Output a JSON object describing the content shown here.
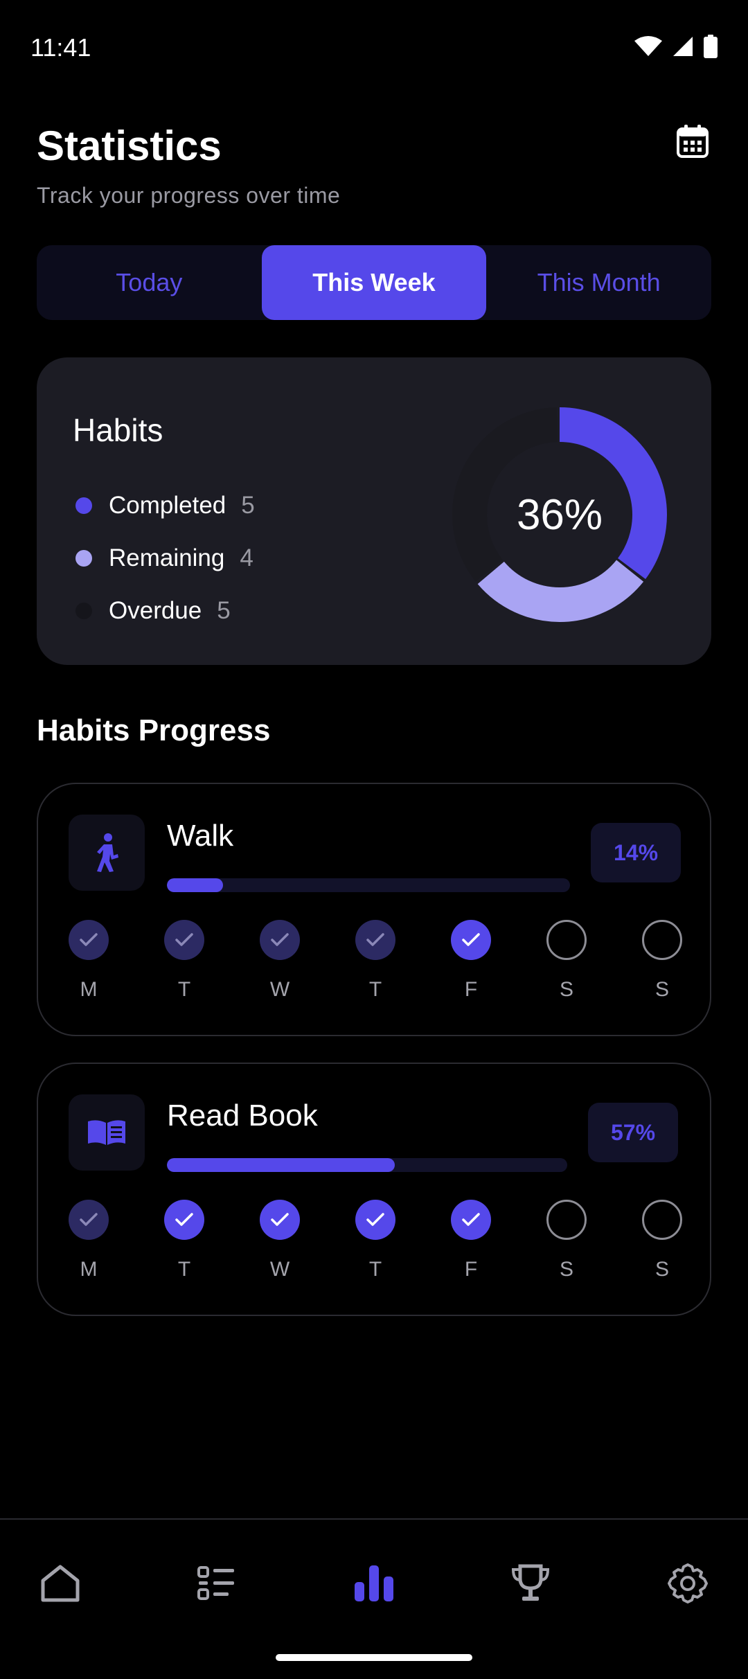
{
  "status": {
    "time": "11:41"
  },
  "header": {
    "title": "Statistics",
    "subtitle": "Track your progress over time"
  },
  "tabs": [
    {
      "label": "Today",
      "active": false
    },
    {
      "label": "This Week",
      "active": true
    },
    {
      "label": "This Month",
      "active": false
    }
  ],
  "habits_summary": {
    "title": "Habits",
    "percent_label": "36%",
    "legend": [
      {
        "label": "Completed",
        "count": "5",
        "color": "#5548ea"
      },
      {
        "label": "Remaining",
        "count": "4",
        "color": "#a9a4f3"
      },
      {
        "label": "Overdue",
        "count": "5",
        "color": "#1a1a20"
      }
    ]
  },
  "section": {
    "title": "Habits Progress"
  },
  "habits": [
    {
      "name": "Walk",
      "icon": "walk-icon",
      "percent_label": "14%",
      "progress": 0.14,
      "days": [
        {
          "letter": "M",
          "state": "past"
        },
        {
          "letter": "T",
          "state": "past"
        },
        {
          "letter": "W",
          "state": "past"
        },
        {
          "letter": "T",
          "state": "past"
        },
        {
          "letter": "F",
          "state": "done"
        },
        {
          "letter": "S",
          "state": "empty"
        },
        {
          "letter": "S",
          "state": "empty"
        }
      ]
    },
    {
      "name": "Read Book",
      "icon": "book-icon",
      "percent_label": "57%",
      "progress": 0.57,
      "days": [
        {
          "letter": "M",
          "state": "past"
        },
        {
          "letter": "T",
          "state": "done"
        },
        {
          "letter": "W",
          "state": "done"
        },
        {
          "letter": "T",
          "state": "done"
        },
        {
          "letter": "F",
          "state": "done"
        },
        {
          "letter": "S",
          "state": "empty"
        },
        {
          "letter": "S",
          "state": "empty"
        }
      ]
    }
  ],
  "nav": [
    {
      "icon": "home-icon",
      "active": false
    },
    {
      "icon": "list-icon",
      "active": false
    },
    {
      "icon": "bar-chart-icon",
      "active": true
    },
    {
      "icon": "trophy-icon",
      "active": false
    },
    {
      "icon": "gear-icon",
      "active": false
    }
  ],
  "colors": {
    "accent": "#5548ea",
    "muted": "#9a9aa3"
  }
}
